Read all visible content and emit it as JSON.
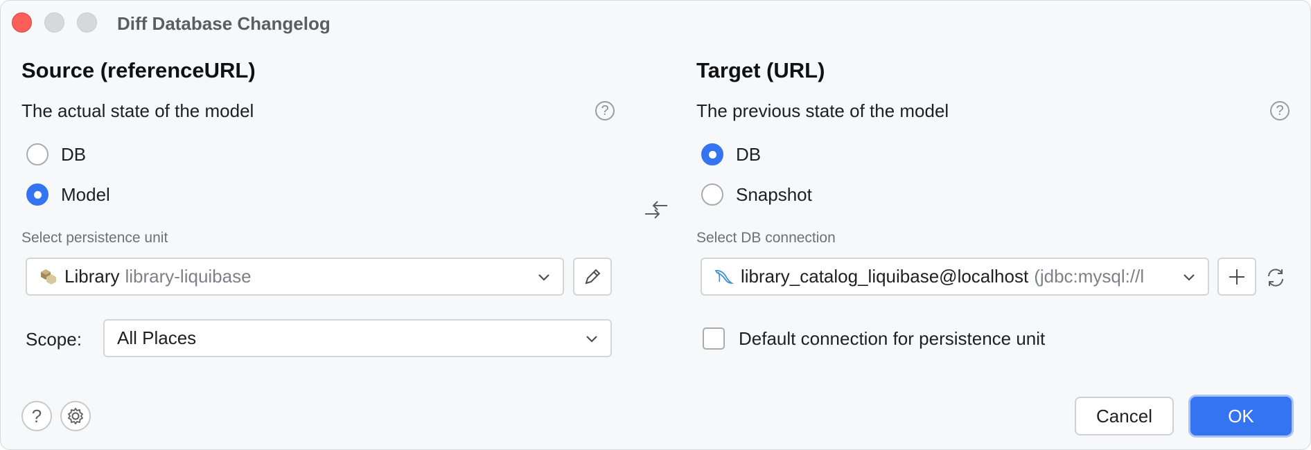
{
  "window": {
    "title": "Diff Database Changelog"
  },
  "source": {
    "heading": "Source (referenceURL)",
    "subtitle": "The actual state of the model",
    "help": "?",
    "options": [
      {
        "label": "DB",
        "selected": false
      },
      {
        "label": "Model",
        "selected": true
      }
    ],
    "persistence_label": "Select persistence unit",
    "persistence_value": "Library",
    "persistence_detail": "library-liquibase",
    "scope_label": "Scope:",
    "scope_value": "All Places"
  },
  "swap_icon": "swap-arrows-icon",
  "target": {
    "heading": "Target (URL)",
    "subtitle": "The previous state of the model",
    "help": "?",
    "options": [
      {
        "label": "DB",
        "selected": true
      },
      {
        "label": "Snapshot",
        "selected": false
      }
    ],
    "connection_label": "Select DB connection",
    "connection_value": "library_catalog_liquibase@localhost",
    "connection_detail": "(jdbc:mysql://l",
    "default_connection_label": "Default connection for persistence unit",
    "default_connection_checked": false
  },
  "footer": {
    "help": "?",
    "cancel_label": "Cancel",
    "ok_label": "OK"
  },
  "colors": {
    "accent": "#3574f0",
    "close": "#fe5f57"
  }
}
